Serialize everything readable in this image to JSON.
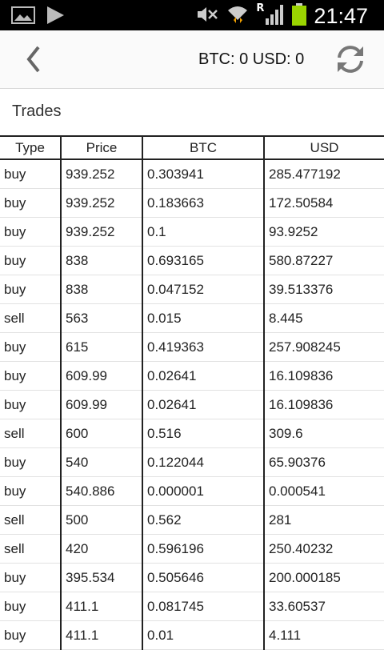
{
  "status_bar": {
    "time": "21:47",
    "icons": [
      "gallery-icon",
      "play-store-icon",
      "mute-icon",
      "wifi-icon",
      "roaming-indicator",
      "signal-icon",
      "battery-icon"
    ],
    "roaming_letter": "R",
    "battery_color": "#9ad400"
  },
  "action_bar": {
    "balance": "BTC: 0 USD: 0",
    "back_icon": "back-arrow-icon",
    "refresh_icon": "refresh-icon"
  },
  "section": {
    "title": "Trades"
  },
  "table": {
    "headers": [
      "Type",
      "Price",
      "BTC",
      "USD"
    ],
    "rows": [
      [
        "buy",
        "939.252",
        "0.303941",
        "285.477192"
      ],
      [
        "buy",
        "939.252",
        "0.183663",
        "172.50584"
      ],
      [
        "buy",
        "939.252",
        "0.1",
        "93.9252"
      ],
      [
        "buy",
        "838",
        "0.693165",
        "580.87227"
      ],
      [
        "buy",
        "838",
        "0.047152",
        "39.513376"
      ],
      [
        "sell",
        "563",
        "0.015",
        "8.445"
      ],
      [
        "buy",
        "615",
        "0.419363",
        "257.908245"
      ],
      [
        "buy",
        "609.99",
        "0.02641",
        "16.109836"
      ],
      [
        "buy",
        "609.99",
        "0.02641",
        "16.109836"
      ],
      [
        "sell",
        "600",
        "0.516",
        "309.6"
      ],
      [
        "buy",
        "540",
        "0.122044",
        "65.90376"
      ],
      [
        "buy",
        "540.886",
        "0.000001",
        "0.000541"
      ],
      [
        "sell",
        "500",
        "0.562",
        "281"
      ],
      [
        "sell",
        "420",
        "0.596196",
        "250.40232"
      ],
      [
        "buy",
        "395.534",
        "0.505646",
        "200.000185"
      ],
      [
        "buy",
        "411.1",
        "0.081745",
        "33.60537"
      ],
      [
        "buy",
        "411.1",
        "0.01",
        "4.111"
      ]
    ]
  }
}
